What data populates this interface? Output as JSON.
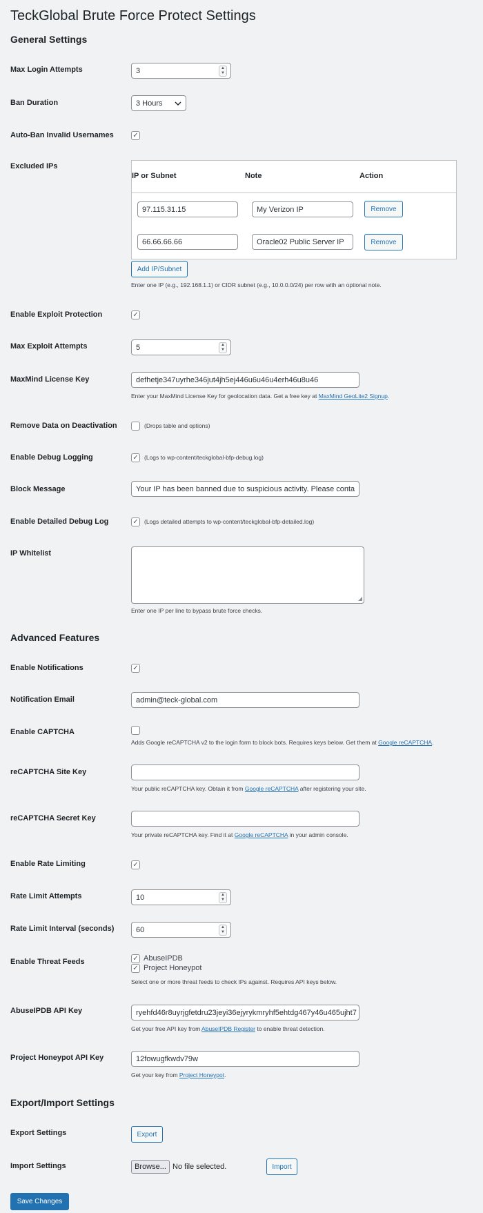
{
  "page": {
    "title": "TeckGlobal Brute Force Protect Settings"
  },
  "general": {
    "heading": "General Settings",
    "max_login": {
      "label": "Max Login Attempts",
      "value": "3"
    },
    "ban_duration": {
      "label": "Ban Duration",
      "value": "3 Hours"
    },
    "auto_ban": {
      "label": "Auto-Ban Invalid Usernames",
      "checked": true
    },
    "excluded": {
      "label": "Excluded IPs",
      "col_ip": "IP or Subnet",
      "col_note": "Note",
      "col_action": "Action",
      "rows": [
        {
          "ip": "97.115.31.15",
          "note": "My Verizon IP",
          "action": "Remove"
        },
        {
          "ip": "66.66.66.66",
          "note": "Oracle02 Public Server IP",
          "action": "Remove"
        }
      ],
      "add_button": "Add IP/Subnet",
      "desc": "Enter one IP (e.g., 192.168.1.1) or CIDR subnet (e.g., 10.0.0.0/24) per row with an optional note."
    },
    "exploit": {
      "label": "Enable Exploit Protection",
      "checked": true
    },
    "max_exploit": {
      "label": "Max Exploit Attempts",
      "value": "5"
    },
    "maxmind": {
      "label": "MaxMind License Key",
      "value": "defhetje347uyrhe346jut4jh5ej446u6u46u4erh46u8u46",
      "desc_prefix": "Enter your MaxMind License Key for geolocation data. Get a free key at ",
      "desc_link": "MaxMind GeoLite2 Signup",
      "desc_suffix": "."
    },
    "remove_data": {
      "label": "Remove Data on Deactivation",
      "checked": false,
      "note": "(Drops table and options)"
    },
    "debug": {
      "label": "Enable Debug Logging",
      "checked": true,
      "note": "(Logs to wp-content/teckglobal-bfp-debug.log)"
    },
    "block_msg": {
      "label": "Block Message",
      "value": "Your IP has been banned due to suspicious activity. Please conta"
    },
    "detailed_debug": {
      "label": "Enable Detailed Debug Log",
      "checked": true,
      "note": "(Logs detailed attempts to wp-content/teckglobal-bfp-detailed.log)"
    },
    "whitelist": {
      "label": "IP Whitelist",
      "value": "",
      "desc": "Enter one IP per line to bypass brute force checks."
    }
  },
  "advanced": {
    "heading": "Advanced Features",
    "notifications": {
      "label": "Enable Notifications",
      "checked": true
    },
    "email": {
      "label": "Notification Email",
      "value": "admin@teck-global.com"
    },
    "captcha": {
      "label": "Enable CAPTCHA",
      "checked": false,
      "desc_prefix": "Adds Google reCAPTCHA v2 to the login form to block bots. Requires keys below. Get them at ",
      "desc_link": "Google reCAPTCHA",
      "desc_suffix": "."
    },
    "site_key": {
      "label": "reCAPTCHA Site Key",
      "value": "",
      "desc_prefix": "Your public reCAPTCHA key. Obtain it from ",
      "desc_link": "Google reCAPTCHA",
      "desc_suffix": " after registering your site."
    },
    "secret_key": {
      "label": "reCAPTCHA Secret Key",
      "value": "",
      "desc_prefix": "Your private reCAPTCHA key. Find it at ",
      "desc_link": "Google reCAPTCHA",
      "desc_suffix": " in your admin console."
    },
    "rate_limit": {
      "label": "Enable Rate Limiting",
      "checked": true
    },
    "rate_attempts": {
      "label": "Rate Limit Attempts",
      "value": "10"
    },
    "rate_interval": {
      "label": "Rate Limit Interval (seconds)",
      "value": "60"
    },
    "threat_feeds": {
      "label": "Enable Threat Feeds",
      "abuseipdb": {
        "label": "AbuseIPDB",
        "checked": true
      },
      "honeypot": {
        "label": "Project Honeypot",
        "checked": true
      },
      "desc": "Select one or more threat feeds to check IPs against. Requires API keys below."
    },
    "abuse_key": {
      "label": "AbuseIPDB API Key",
      "value": "ryehfd46r8uyrjgfetdru23jeyi36ejyrykmryhf5ehtdg467y46u465ujht7",
      "desc_prefix": "Get your free API key from ",
      "desc_link": "AbuseIPDB Register",
      "desc_suffix": " to enable threat detection."
    },
    "honeypot_key": {
      "label": "Project Honeypot API Key",
      "value": "12fowugfkwdv79w",
      "desc_prefix": "Get your key from ",
      "desc_link": "Project Honeypot",
      "desc_suffix": "."
    }
  },
  "export_import": {
    "heading": "Export/Import Settings",
    "export": {
      "label": "Export Settings",
      "button": "Export"
    },
    "import": {
      "label": "Import Settings",
      "browse": "Browse...",
      "file_text": "No file selected.",
      "button": "Import"
    }
  },
  "save_button": "Save Changes",
  "colors": {
    "accent": "#2271b1",
    "background": "#f1f2f4"
  }
}
